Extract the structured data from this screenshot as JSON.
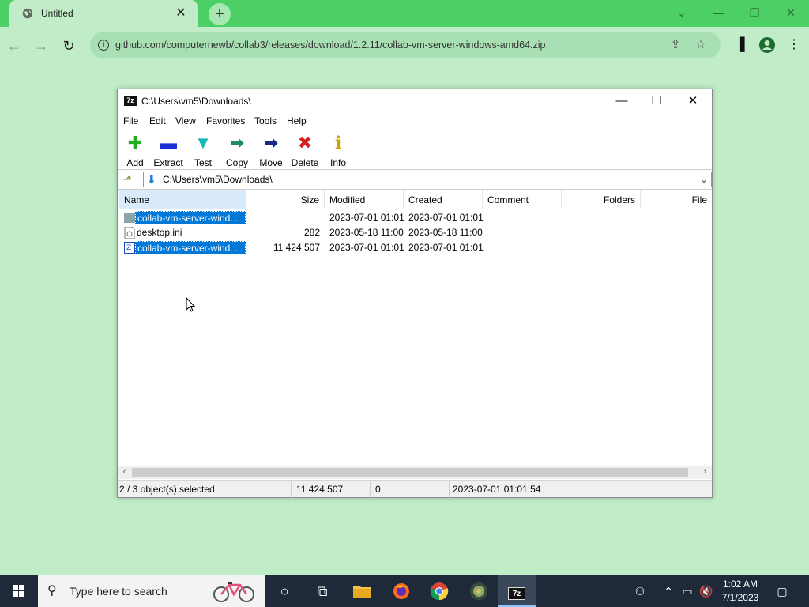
{
  "browser": {
    "tab_title": "Untitled",
    "url": "github.com/computernewb/collab3/releases/download/1.2.11/collab-vm-server-windows-amd64.zip"
  },
  "zip_window": {
    "title": "C:\\Users\\vm5\\Downloads\\",
    "app_icon_text": "7z",
    "menu": [
      "File",
      "Edit",
      "View",
      "Favorites",
      "Tools",
      "Help"
    ],
    "toolbar": [
      {
        "label": "Add",
        "icon": "add-plus-icon",
        "color": "#1fae1f"
      },
      {
        "label": "Extract",
        "icon": "extract-minus-icon",
        "color": "#1a2fd6"
      },
      {
        "label": "Test",
        "icon": "test-check-icon",
        "color": "#18b7b7"
      },
      {
        "label": "Copy",
        "icon": "copy-arrow-icon",
        "color": "#1f8a6b"
      },
      {
        "label": "Move",
        "icon": "move-arrow-icon",
        "color": "#162a8a"
      },
      {
        "label": "Delete",
        "icon": "delete-x-icon",
        "color": "#d81f1f"
      },
      {
        "label": "Info",
        "icon": "info-i-icon",
        "color": "#c9a300"
      }
    ],
    "address": "C:\\Users\\vm5\\Downloads\\",
    "columns": [
      "Name",
      "Size",
      "Modified",
      "Created",
      "Comment",
      "Folders",
      "File"
    ],
    "rows": [
      {
        "name": "collab-vm-server-wind...",
        "size": "",
        "modified": "2023-07-01 01:01",
        "created": "2023-07-01 01:01",
        "selected": true,
        "icon": "folder-icon"
      },
      {
        "name": "desktop.ini",
        "size": "282",
        "modified": "2023-05-18 11:00",
        "created": "2023-05-18 11:00",
        "selected": false,
        "icon": "ini-file-icon"
      },
      {
        "name": "collab-vm-server-wind...",
        "size": "11 424 507",
        "modified": "2023-07-01 01:01",
        "created": "2023-07-01 01:01",
        "selected": true,
        "icon": "zip-file-icon"
      }
    ],
    "status": {
      "selection": "2 / 3 object(s) selected",
      "size": "11 424 507",
      "packed": "0",
      "date": "2023-07-01 01:01:54"
    }
  },
  "taskbar": {
    "search_placeholder": "Type here to search",
    "time": "1:02 AM",
    "date": "7/1/2023"
  }
}
